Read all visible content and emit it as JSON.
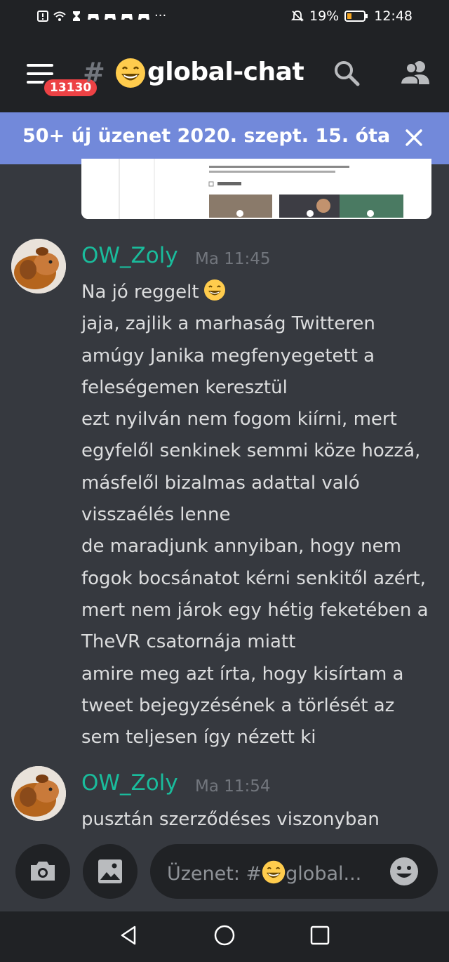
{
  "status_bar": {
    "battery_percent": "19%",
    "time": "12:48",
    "icons": [
      "alert-icon",
      "wifi-icon",
      "hourglass-icon",
      "game-controller-icon",
      "game-controller-icon",
      "game-controller-icon",
      "game-controller-icon",
      "more-dots-icon",
      "mute-bell-icon",
      "battery-icon"
    ]
  },
  "header": {
    "unread_badge": "13130",
    "channel_hash": "#",
    "channel_name": "global-chat",
    "channel_emoji": "grinning-face"
  },
  "new_messages_banner": {
    "text": "50+ új üzenet 2020. szept. 15. óta"
  },
  "messages": [
    {
      "author": "OW_Zoly",
      "time": "Ma 11:45",
      "lines": [
        "Na jó reggelt",
        "jaja, zajlik a marhaság Twitteren",
        "amúgy Janika megfenyegetett a",
        "feleségemen keresztül",
        "ezt nyilván nem fogom kiírni, mert",
        "egyfelől senkinek semmi köze hozzá,",
        "másfelől bizalmas adattal való",
        "visszaélés lenne",
        "de maradjunk annyiban, hogy nem",
        "fogok bocsánatot kérni senkitől azért,",
        "mert nem járok egy hétig feketében a",
        "TheVR csatornája miatt",
        "amire meg azt írta, hogy kisírtam a",
        "tweet bejegyzésének a törlését az",
        "sem teljesen így nézett ki"
      ]
    },
    {
      "author": "OW_Zoly",
      "time": "Ma 11:54",
      "lines": [
        "pusztán szerződéses viszonyban"
      ]
    }
  ],
  "composer": {
    "placeholder_prefix": "Üzenet: #",
    "placeholder_suffix": "global..."
  },
  "colors": {
    "background": "#36393f",
    "bar": "#202225",
    "banner": "#7289da",
    "author": "#1abc9c",
    "badge": "#ed4245"
  }
}
